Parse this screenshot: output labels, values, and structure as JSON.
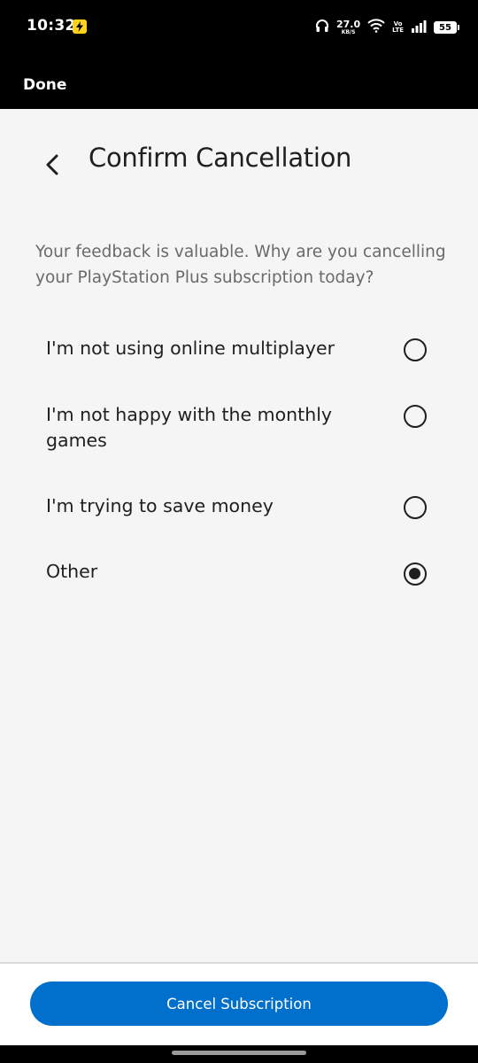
{
  "status_bar": {
    "time": "10:32",
    "speed_value": "27.0",
    "speed_unit": "KB/S",
    "volte_top": "Vo",
    "volte_bottom": "LTE",
    "battery": "55"
  },
  "top_bar": {
    "done_label": "Done"
  },
  "header": {
    "title": "Confirm Cancellation",
    "back_icon": "chevron-left-icon"
  },
  "prompt": "Your feedback is valuable. Why are you cancelling your PlayStation Plus subscription today?",
  "options": [
    {
      "label": "I'm not using online multiplayer",
      "selected": false
    },
    {
      "label": "I'm not happy with the monthly games",
      "selected": false
    },
    {
      "label": "I'm trying to save money",
      "selected": false
    },
    {
      "label": "Other",
      "selected": true
    }
  ],
  "footer": {
    "cancel_label": "Cancel Subscription"
  },
  "colors": {
    "accent": "#0070cc",
    "background": "#f5f5f5",
    "text": "#1f1f1f",
    "muted_text": "#6a6a6a"
  }
}
